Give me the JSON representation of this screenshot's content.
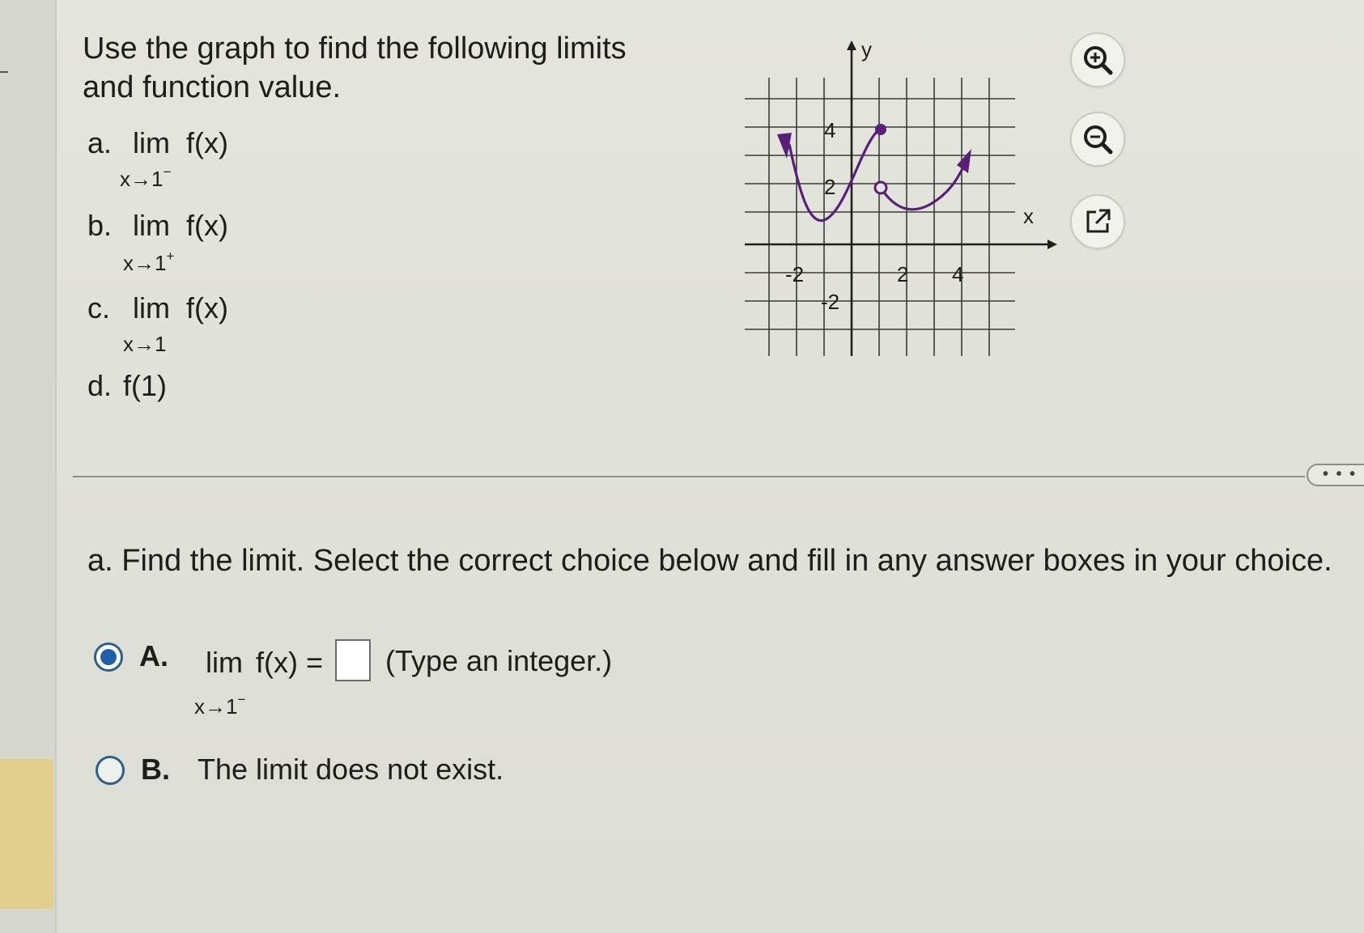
{
  "intro": {
    "line1": "Use the graph to find the following limits",
    "line2": "and function value."
  },
  "parts": [
    {
      "letter": "a.",
      "expr": "lim  f(x)",
      "sub": "x→1",
      "sup": "−"
    },
    {
      "letter": "b.",
      "expr": "lim  f(x)",
      "sub": "x→1",
      "sup": "+"
    },
    {
      "letter": "c.",
      "expr": "lim  f(x)",
      "sub": "x→1",
      "sup": ""
    },
    {
      "letter": "d.",
      "expr": "f(1)"
    }
  ],
  "graph": {
    "x_label": "x",
    "y_label": "y",
    "x_ticks": [
      "-2",
      "2",
      "4"
    ],
    "y_ticks": [
      "4",
      "2",
      "-2"
    ]
  },
  "tools": {
    "zoom_in": "zoom-in-icon",
    "zoom_out": "zoom-out-icon",
    "popout": "open-external-icon"
  },
  "more_label": "• • •",
  "question": "a. Find the limit. Select the correct choice below and fill in any answer boxes in your choice.",
  "choice_a": {
    "letter": "A.",
    "lim": "lim",
    "func": "f(x) =",
    "sub": "x→1",
    "sup": "−",
    "hint": "(Type an integer.)",
    "answer_value": "",
    "selected": true
  },
  "choice_b": {
    "letter": "B.",
    "text": "The limit does not exist.",
    "selected": false
  },
  "colors": {
    "curve": "#5a1f7a",
    "radio": "#1f5fa8",
    "highlight": "#e3cf8d"
  }
}
